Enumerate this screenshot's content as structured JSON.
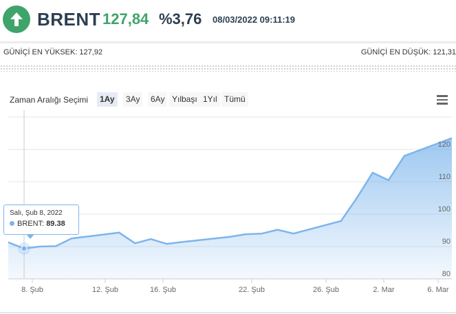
{
  "header": {
    "symbol": "BRENT",
    "price": "127,84",
    "change": "%3,76",
    "datetime": "08/03/2022 09:11:19",
    "direction_icon": "arrow-up-icon",
    "up_color": "#3fa46a"
  },
  "stats": {
    "high_label": "GÜNİÇİ EN YÜKSEK: 127,92",
    "low_label": "GÜNİÇİ EN DÜŞÜK: 121,31"
  },
  "range_selector": {
    "label": "Zaman Aralığı Seçimi",
    "buttons": [
      "1Ay",
      "3Ay",
      "6Ay",
      "Yılbaşı",
      "1Yıl",
      "Tümü"
    ],
    "active": "1Ay"
  },
  "tooltip": {
    "date": "Salı, Şub 8, 2022",
    "series": "BRENT:",
    "value": "89.38"
  },
  "chart_data": {
    "type": "area",
    "series": [
      {
        "name": "BRENT",
        "color": "#7cb5ec",
        "points": [
          [
            "2022-02-07",
            91.3
          ],
          [
            "2022-02-08",
            89.38
          ],
          [
            "2022-02-09",
            90.0
          ],
          [
            "2022-02-10",
            90.1
          ],
          [
            "2022-02-11",
            92.5
          ],
          [
            "2022-02-14",
            94.3
          ],
          [
            "2022-02-15",
            91.0
          ],
          [
            "2022-02-16",
            92.3
          ],
          [
            "2022-02-17",
            90.8
          ],
          [
            "2022-02-18",
            91.4
          ],
          [
            "2022-02-21",
            93.0
          ],
          [
            "2022-02-22",
            93.8
          ],
          [
            "2022-02-23",
            94.0
          ],
          [
            "2022-02-24",
            95.2
          ],
          [
            "2022-02-25",
            94.0
          ],
          [
            "2022-02-28",
            97.9
          ],
          [
            "2022-03-01",
            105.0
          ],
          [
            "2022-03-02",
            112.8
          ],
          [
            "2022-03-03",
            110.5
          ],
          [
            "2022-03-04",
            118.0
          ],
          [
            "2022-03-07",
            123.5
          ]
        ]
      }
    ],
    "x_tick_labels": [
      "8. Şub",
      "12. Şub",
      "16. Şub",
      "22. Şub",
      "26. Şub",
      "2. Mar",
      "6. Mar"
    ],
    "y_tick_labels": [
      "80",
      "90",
      "100",
      "110",
      "120"
    ],
    "ylim": [
      80,
      130
    ],
    "grid": true
  }
}
